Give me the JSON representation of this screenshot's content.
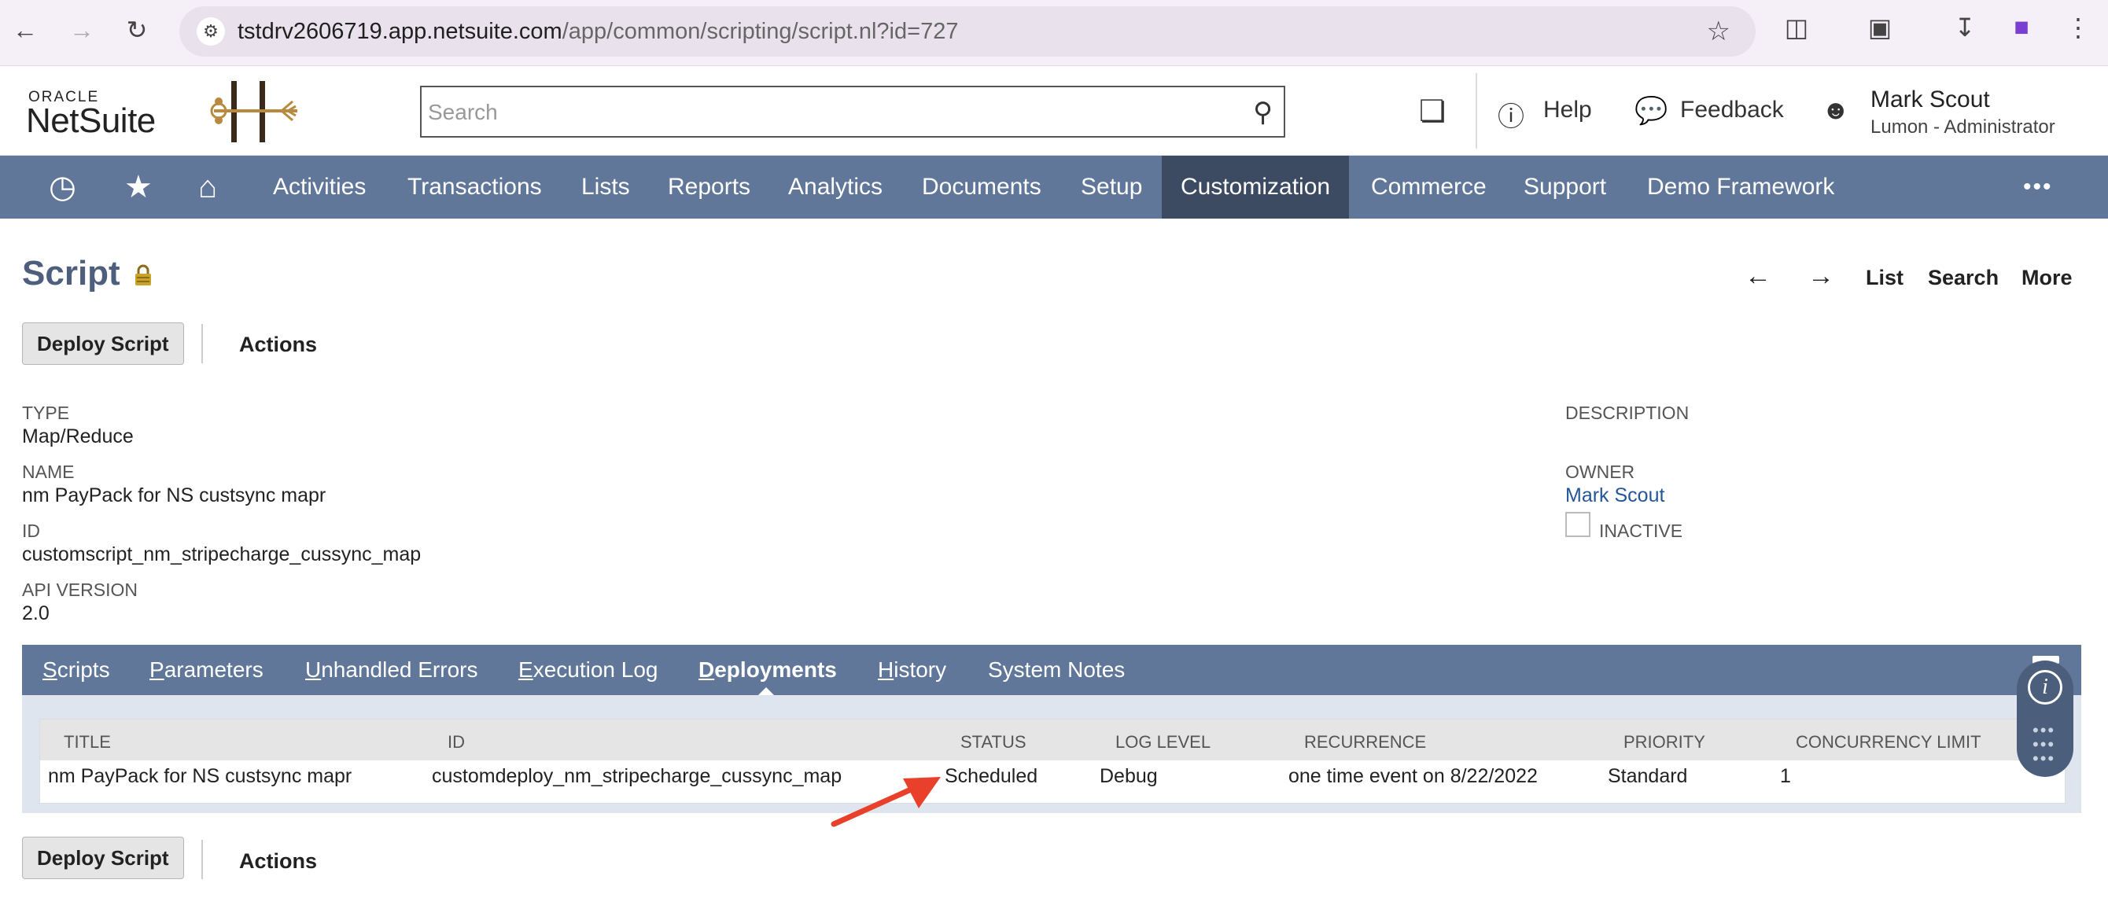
{
  "browser": {
    "url_host": "tstdrv2606719.app.netsuite.com",
    "url_path": "/app/common/scripting/script.nl?id=727"
  },
  "header": {
    "logo_top": "ORACLE",
    "logo_bottom": "NetSuite",
    "search_placeholder": "Search",
    "help_label": "Help",
    "feedback_label": "Feedback",
    "user_name": "Mark Scout",
    "user_role": "Lumon - Administrator"
  },
  "mainnav": {
    "items": [
      "Activities",
      "Transactions",
      "Lists",
      "Reports",
      "Analytics",
      "Documents",
      "Setup",
      "Customization",
      "Commerce",
      "Support",
      "Demo Framework"
    ],
    "active": "Customization",
    "more": "•••"
  },
  "page": {
    "title": "Script",
    "nav_list": "List",
    "nav_search": "Search",
    "nav_more": "More",
    "deploy_button": "Deploy Script",
    "actions_label": "Actions"
  },
  "fields": {
    "type_label": "TYPE",
    "type_value": "Map/Reduce",
    "name_label": "NAME",
    "name_value": "nm PayPack for NS custsync mapr",
    "id_label": "ID",
    "id_value": "customscript_nm_stripecharge_cussync_map",
    "api_label": "API VERSION",
    "api_value": "2.0",
    "description_label": "DESCRIPTION",
    "owner_label": "OWNER",
    "owner_value": "Mark Scout",
    "inactive_label": "INACTIVE"
  },
  "subtabs": {
    "tabs": [
      {
        "first": "S",
        "rest": "cripts"
      },
      {
        "first": "P",
        "rest": "arameters"
      },
      {
        "first": "U",
        "rest": "nhandled Errors"
      },
      {
        "first": "E",
        "rest": "xecution Log"
      },
      {
        "first": "D",
        "rest": "eployments"
      },
      {
        "first": "H",
        "rest": "istory"
      },
      {
        "first": "",
        "rest": "System Notes"
      }
    ],
    "active_index": 4
  },
  "deployments": {
    "columns": [
      "TITLE",
      "ID",
      "STATUS",
      "LOG LEVEL",
      "RECURRENCE",
      "PRIORITY",
      "CONCURRENCY LIMIT"
    ],
    "rows": [
      {
        "title": "nm PayPack for NS custsync mapr",
        "id": "customdeploy_nm_stripecharge_cussync_map",
        "status": "Scheduled",
        "log_level": "Debug",
        "recurrence": "one time event on 8/22/2022",
        "priority": "Standard",
        "concurrency": "1"
      }
    ]
  },
  "colors": {
    "nav_bg": "#607799",
    "nav_active": "#3c4a62",
    "title_color": "#4d5f7c",
    "link": "#255599",
    "annotation_arrow": "#e8402a"
  }
}
